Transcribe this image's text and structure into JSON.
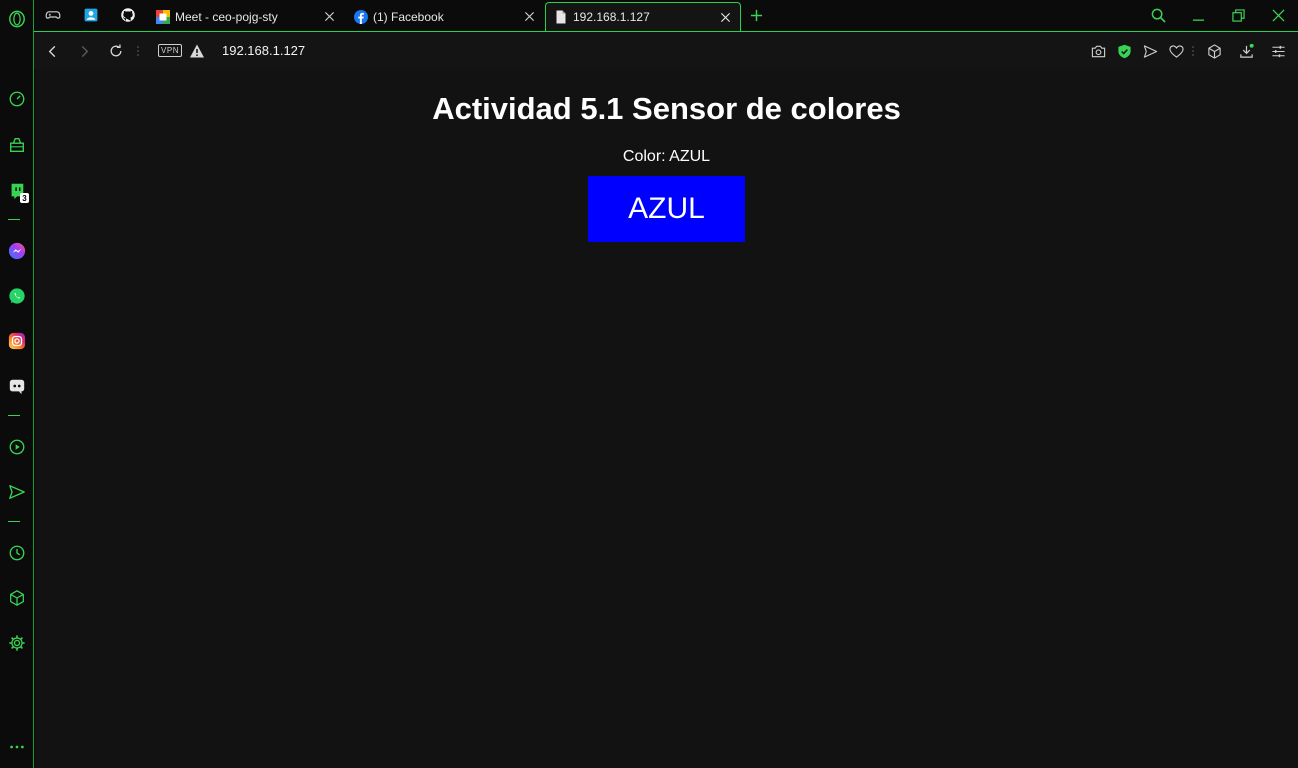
{
  "tabs": [
    {
      "label": "Meet - ceo-pojg-sty",
      "active": false
    },
    {
      "label": "(1) Facebook",
      "active": false
    },
    {
      "label": "192.168.1.127",
      "active": true
    }
  ],
  "address_bar": {
    "vpn_label": "VPN",
    "url": "192.168.1.127"
  },
  "sidebar": {
    "twitch_badge": "3"
  },
  "page": {
    "heading": "Actividad 5.1 Sensor de colores",
    "status_text": "Color: AZUL",
    "color_box_label": "AZUL",
    "color_box_color": "#0000ff"
  },
  "theme": {
    "accent": "#2bd14a",
    "page_bg": "#121212"
  }
}
